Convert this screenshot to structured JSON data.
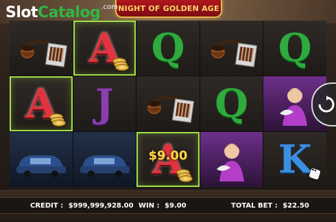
{
  "logo": {
    "slot": "Slot",
    "catalog": "Catalog",
    "com": ".com"
  },
  "game_title": "NIGHT OF GOLDEN AGE",
  "reels": {
    "win_amount_label": "$9.00",
    "letters": {
      "a": "A",
      "j": "J",
      "q": "Q",
      "k": "K"
    }
  },
  "status": {
    "credit_label": "CREDIT :",
    "credit_value": "$999,999,928.00",
    "win_label": "WIN :",
    "win_value": "$9.00",
    "total_bet_label": "TOTAL BET :",
    "total_bet_value": "$22.50"
  },
  "colors": {
    "highlight": "#a2e14a",
    "win_gold": "#ffd64a",
    "title_red": "#b0171f"
  },
  "icons": {
    "spin": "spin-arrows-icon",
    "pipe": "pipe-icon",
    "car": "car-icon",
    "lady": "lady-icon",
    "coins": "coins-icon",
    "dice": "dice-icon",
    "matchbox": "matchbox-icon"
  }
}
